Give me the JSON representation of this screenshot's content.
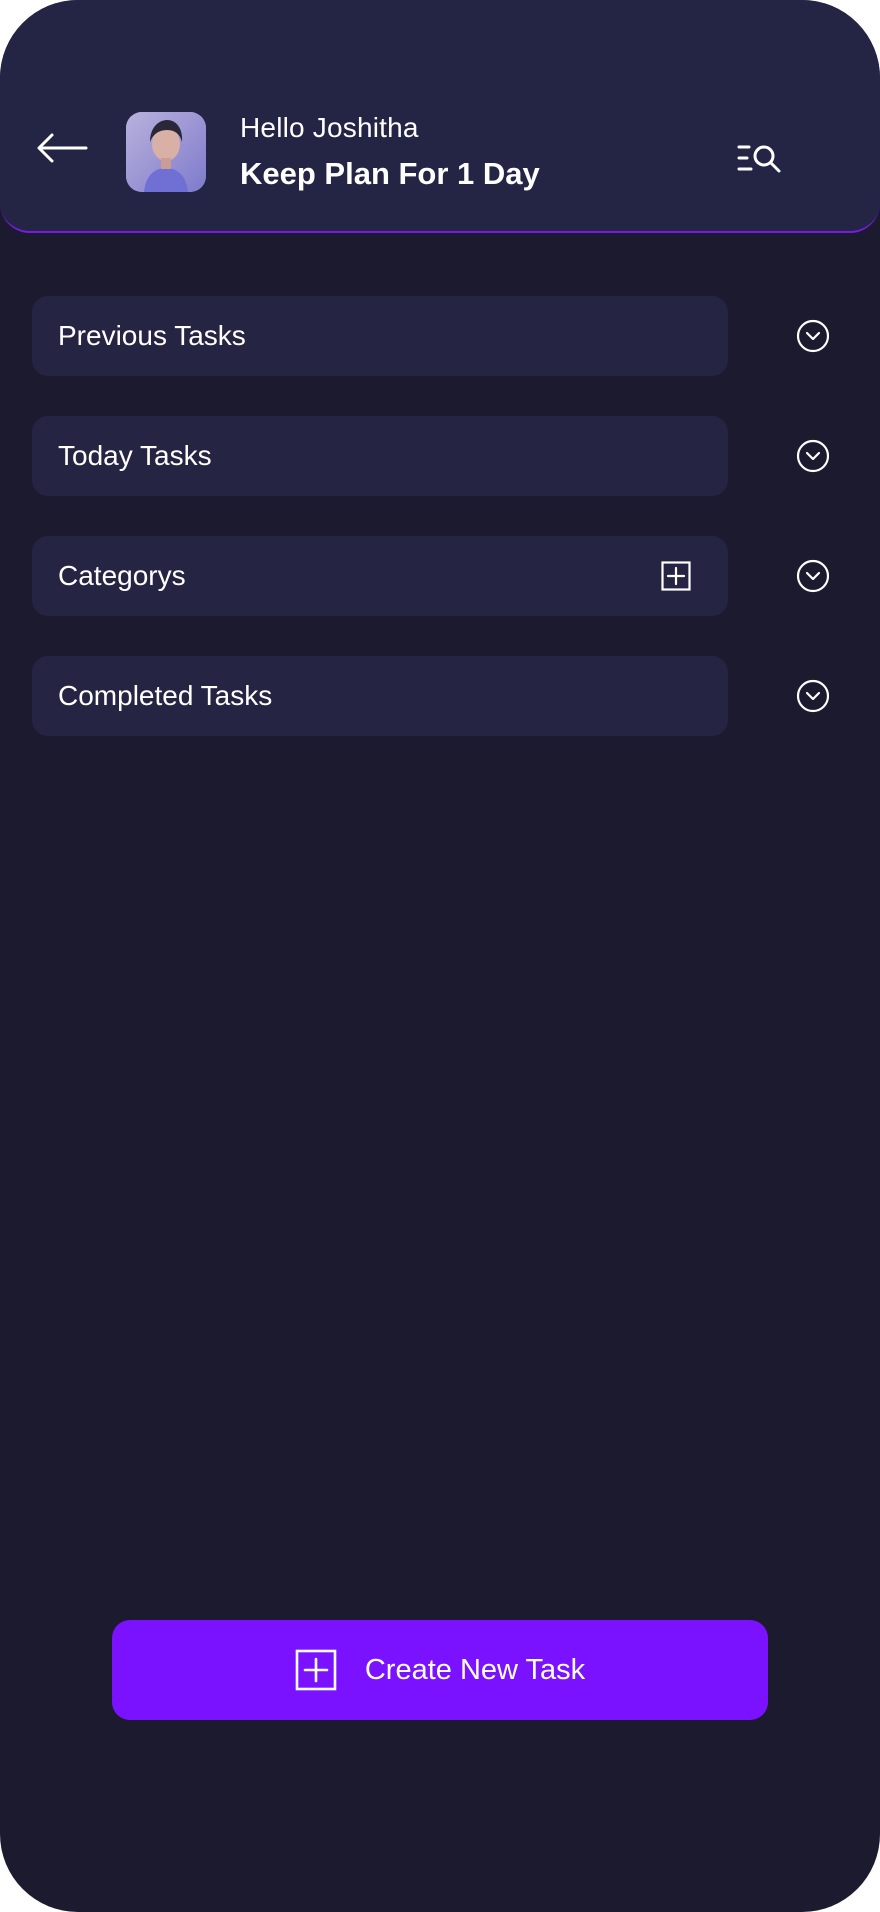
{
  "header": {
    "greeting": "Hello Joshitha",
    "subtitle": "Keep Plan For 1 Day",
    "back_icon": "arrow-left-icon",
    "search_icon": "list-search-icon",
    "background": "#242444",
    "accent_border": "#7a18e8"
  },
  "sections": [
    {
      "label": "Previous Tasks",
      "chevron_icon": "chevron-down-circle-icon"
    },
    {
      "label": "Today Tasks",
      "chevron_icon": "chevron-down-circle-icon"
    },
    {
      "label": "Categorys",
      "add_icon": "plus-square-icon",
      "chevron_icon": "chevron-down-circle-icon"
    },
    {
      "label": "Completed Tasks",
      "chevron_icon": "chevron-down-circle-icon"
    }
  ],
  "create_button": {
    "label": "Create New Task",
    "icon": "plus-square-icon",
    "color": "#7b12ff"
  },
  "colors": {
    "background": "#1b1a2e",
    "row": "#252543",
    "text": "#ffffff"
  }
}
